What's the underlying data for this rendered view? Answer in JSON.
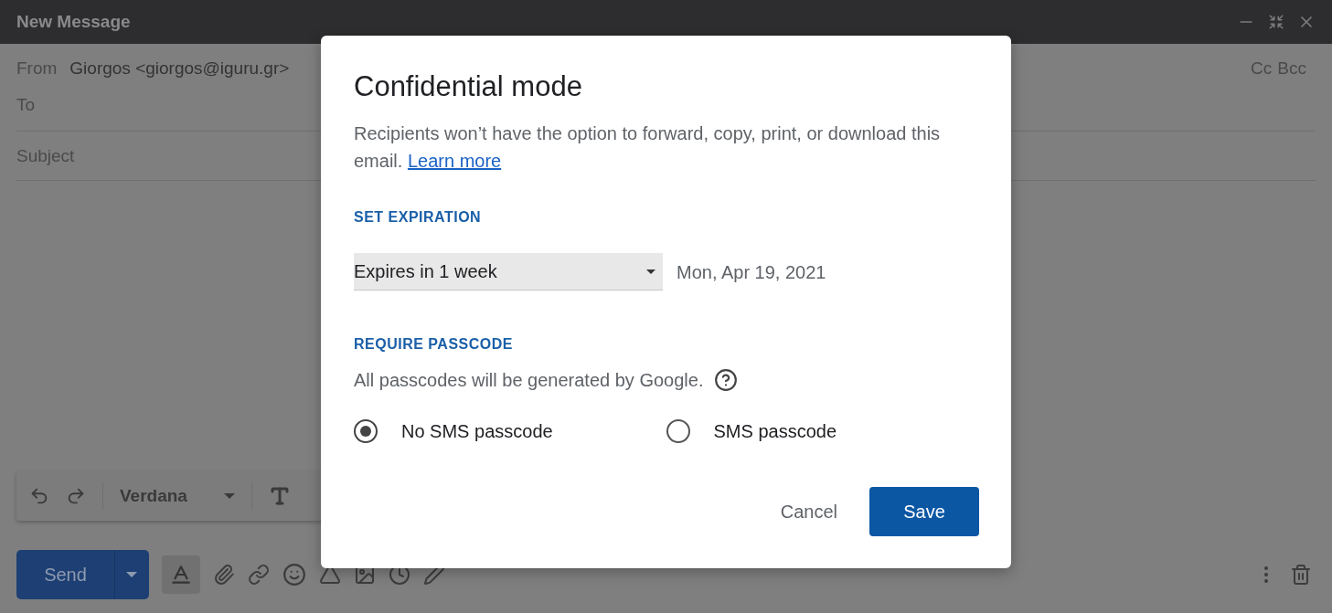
{
  "window": {
    "title": "New Message"
  },
  "compose": {
    "from_label": "From",
    "from_value": "Giorgos <giorgos@iguru.gr>",
    "to_label": "To",
    "cc": "Cc",
    "bcc": "Bcc",
    "subject_placeholder": "Subject"
  },
  "format_bar": {
    "font": "Verdana"
  },
  "actions": {
    "send": "Send",
    "format_toggle": {
      "selected": true
    }
  },
  "dialog": {
    "title": "Confidential mode",
    "description": "Recipients won’t have the option to forward, copy, print, or download this email.",
    "link": "Learn more",
    "expiration": {
      "heading": "SET EXPIRATION",
      "value": "Expires in 1 week",
      "date": "Mon, Apr 19, 2021"
    },
    "passcode": {
      "heading": "REQUIRE PASSCODE",
      "note": "All passcodes will be generated by Google.",
      "options": [
        {
          "label": "No SMS passcode",
          "selected": true
        },
        {
          "label": "SMS passcode",
          "selected": false
        }
      ]
    },
    "buttons": {
      "cancel": "Cancel",
      "save": "Save"
    }
  }
}
